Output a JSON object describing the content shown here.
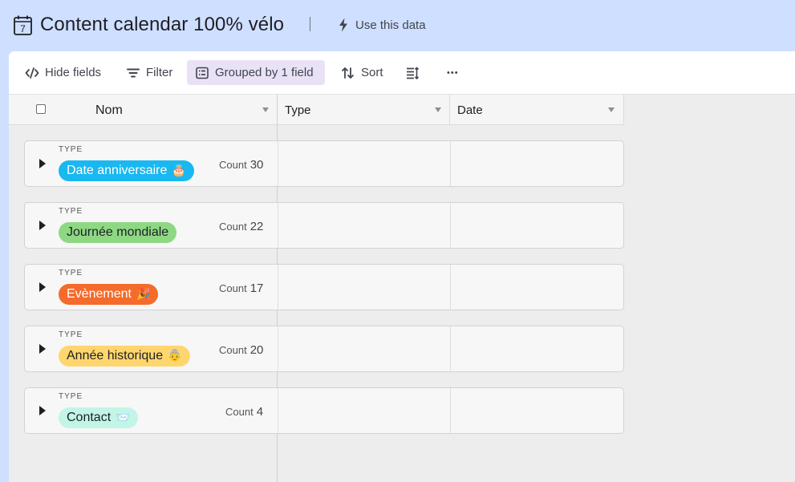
{
  "header": {
    "title": "Content calendar 100% vélo",
    "calendar_icon_day": "7",
    "use_data_label": "Use this data"
  },
  "toolbar": {
    "hide_fields": "Hide fields",
    "filter": "Filter",
    "grouped": "Grouped by 1 field",
    "sort": "Sort",
    "more": "•••"
  },
  "columns": {
    "nom": "Nom",
    "type": "Type",
    "date": "Date"
  },
  "groups": [
    {
      "label": "TYPE",
      "name": "Date anniversaire",
      "emoji": "🎂",
      "count_label": "Count",
      "count": "30",
      "bg": "#19b8f0",
      "fg": "#ffffff"
    },
    {
      "label": "TYPE",
      "name": "Journée mondiale",
      "emoji": "",
      "count_label": "Count",
      "count": "22",
      "bg": "#8ed883",
      "fg": "#1d1f25"
    },
    {
      "label": "TYPE",
      "name": "Evènement",
      "emoji": "🎉",
      "count_label": "Count",
      "count": "17",
      "bg": "#f46b2b",
      "fg": "#ffffff"
    },
    {
      "label": "TYPE",
      "name": "Année historique",
      "emoji": "👵",
      "count_label": "Count",
      "count": "20",
      "bg": "#ffd66e",
      "fg": "#1d1f25"
    },
    {
      "label": "TYPE",
      "name": "Contact",
      "emoji": "📨",
      "count_label": "Count",
      "count": "4",
      "bg": "#c2f5e6",
      "fg": "#1d1f25"
    }
  ]
}
